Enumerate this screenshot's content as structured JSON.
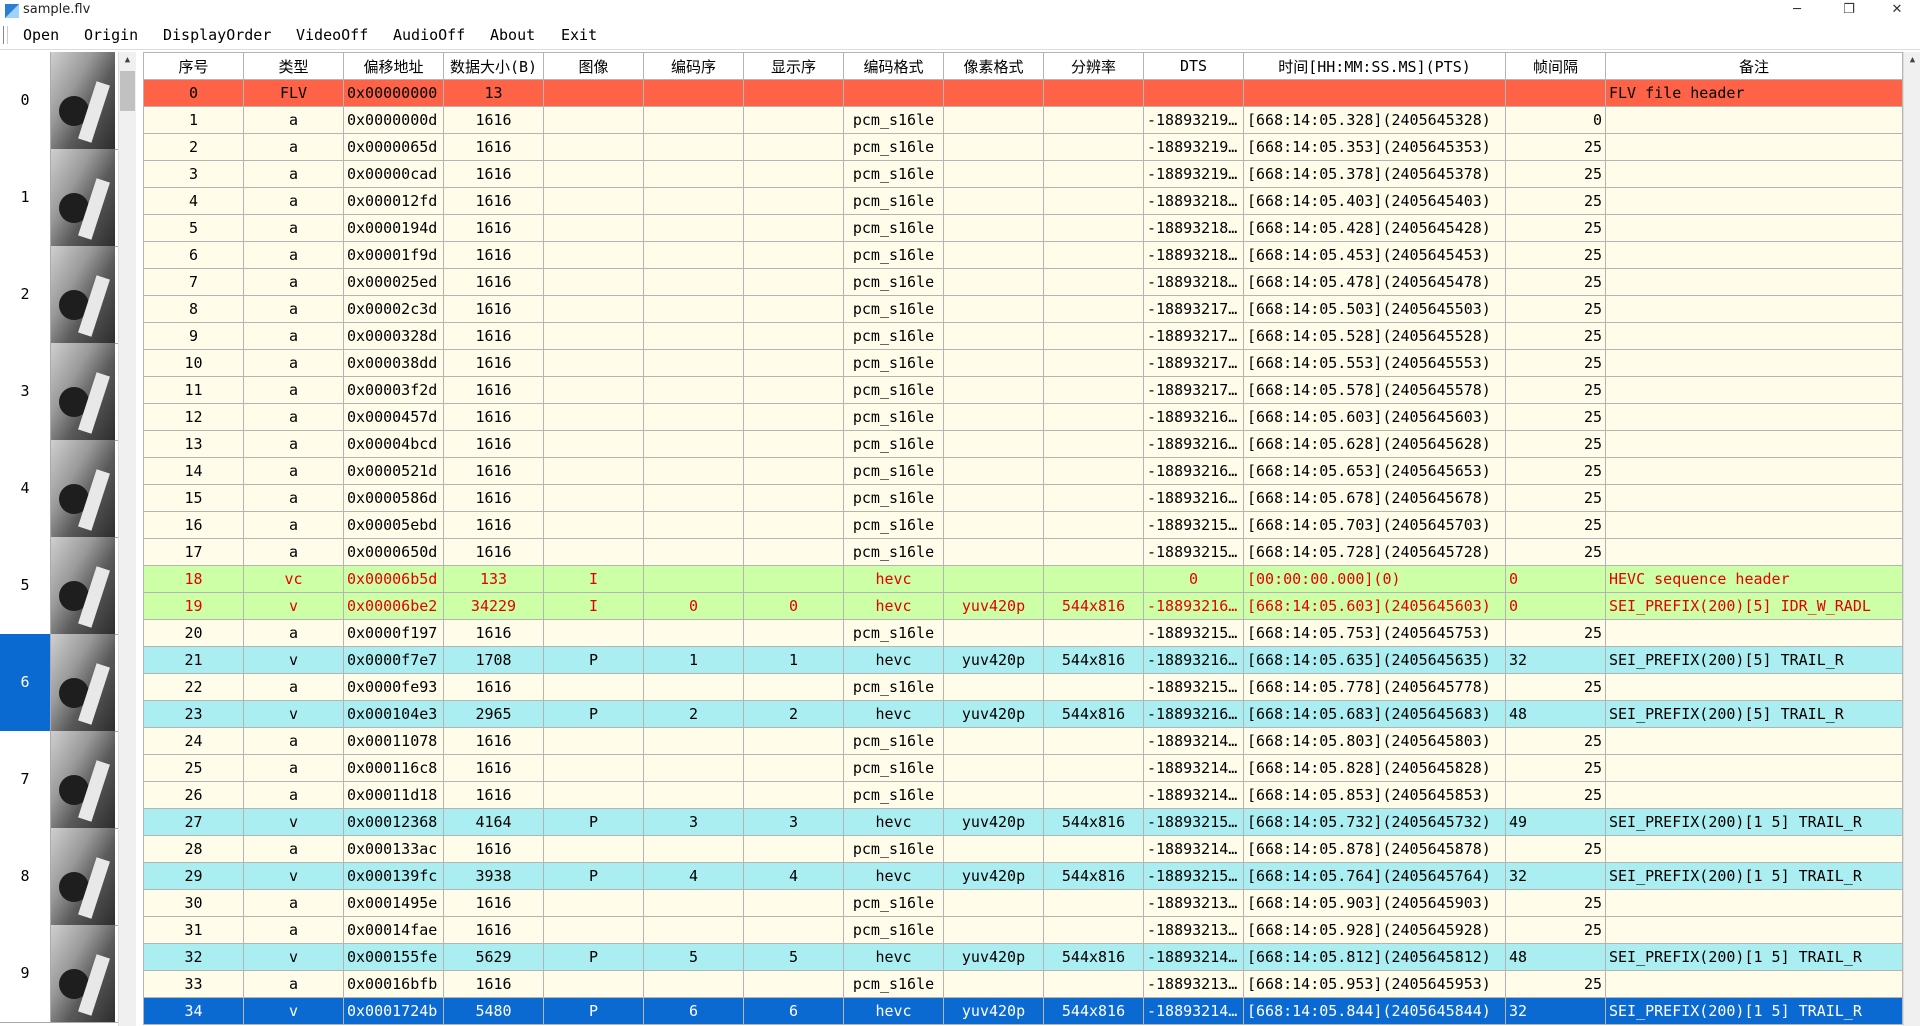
{
  "window": {
    "title": "sample.flv"
  },
  "menu": [
    "Open",
    "Origin",
    "DisplayOrder",
    "VideoOff",
    "AudioOff",
    "About",
    "Exit"
  ],
  "thumbnails": {
    "indices": [
      "0",
      "1",
      "2",
      "3",
      "4",
      "5",
      "6",
      "7",
      "8",
      "9"
    ],
    "selected": "6"
  },
  "table": {
    "columns": [
      "序号",
      "类型",
      "偏移地址",
      "数据大小(B)",
      "图像",
      "编码序",
      "显示序",
      "编码格式",
      "像素格式",
      "分辨率",
      "DTS",
      "时间[HH:MM:SS.MS](PTS)",
      "帧间隔",
      "备注"
    ],
    "rows": [
      {
        "kind": "header",
        "cells": [
          "0",
          "FLV",
          "0x00000000",
          "13",
          "",
          "",
          "",
          "",
          "",
          "",
          "",
          "",
          "",
          "FLV file header"
        ]
      },
      {
        "kind": "audio",
        "cells": [
          "1",
          "a",
          "0x0000000d",
          "1616",
          "",
          "",
          "",
          "pcm_s16le",
          "",
          "",
          "-18893219...",
          "[668:14:05.328](2405645328)",
          "0",
          ""
        ]
      },
      {
        "kind": "audio",
        "cells": [
          "2",
          "a",
          "0x0000065d",
          "1616",
          "",
          "",
          "",
          "pcm_s16le",
          "",
          "",
          "-18893219...",
          "[668:14:05.353](2405645353)",
          "25",
          ""
        ]
      },
      {
        "kind": "audio",
        "cells": [
          "3",
          "a",
          "0x00000cad",
          "1616",
          "",
          "",
          "",
          "pcm_s16le",
          "",
          "",
          "-18893219...",
          "[668:14:05.378](2405645378)",
          "25",
          ""
        ]
      },
      {
        "kind": "audio",
        "cells": [
          "4",
          "a",
          "0x000012fd",
          "1616",
          "",
          "",
          "",
          "pcm_s16le",
          "",
          "",
          "-18893218...",
          "[668:14:05.403](2405645403)",
          "25",
          ""
        ]
      },
      {
        "kind": "audio",
        "cells": [
          "5",
          "a",
          "0x0000194d",
          "1616",
          "",
          "",
          "",
          "pcm_s16le",
          "",
          "",
          "-18893218...",
          "[668:14:05.428](2405645428)",
          "25",
          ""
        ]
      },
      {
        "kind": "audio",
        "cells": [
          "6",
          "a",
          "0x00001f9d",
          "1616",
          "",
          "",
          "",
          "pcm_s16le",
          "",
          "",
          "-18893218...",
          "[668:14:05.453](2405645453)",
          "25",
          ""
        ]
      },
      {
        "kind": "audio",
        "cells": [
          "7",
          "a",
          "0x000025ed",
          "1616",
          "",
          "",
          "",
          "pcm_s16le",
          "",
          "",
          "-18893218...",
          "[668:14:05.478](2405645478)",
          "25",
          ""
        ]
      },
      {
        "kind": "audio",
        "cells": [
          "8",
          "a",
          "0x00002c3d",
          "1616",
          "",
          "",
          "",
          "pcm_s16le",
          "",
          "",
          "-18893217...",
          "[668:14:05.503](2405645503)",
          "25",
          ""
        ]
      },
      {
        "kind": "audio",
        "cells": [
          "9",
          "a",
          "0x0000328d",
          "1616",
          "",
          "",
          "",
          "pcm_s16le",
          "",
          "",
          "-18893217...",
          "[668:14:05.528](2405645528)",
          "25",
          ""
        ]
      },
      {
        "kind": "audio",
        "cells": [
          "10",
          "a",
          "0x000038dd",
          "1616",
          "",
          "",
          "",
          "pcm_s16le",
          "",
          "",
          "-18893217...",
          "[668:14:05.553](2405645553)",
          "25",
          ""
        ]
      },
      {
        "kind": "audio",
        "cells": [
          "11",
          "a",
          "0x00003f2d",
          "1616",
          "",
          "",
          "",
          "pcm_s16le",
          "",
          "",
          "-18893217...",
          "[668:14:05.578](2405645578)",
          "25",
          ""
        ]
      },
      {
        "kind": "audio",
        "cells": [
          "12",
          "a",
          "0x0000457d",
          "1616",
          "",
          "",
          "",
          "pcm_s16le",
          "",
          "",
          "-18893216...",
          "[668:14:05.603](2405645603)",
          "25",
          ""
        ]
      },
      {
        "kind": "audio",
        "cells": [
          "13",
          "a",
          "0x00004bcd",
          "1616",
          "",
          "",
          "",
          "pcm_s16le",
          "",
          "",
          "-18893216...",
          "[668:14:05.628](2405645628)",
          "25",
          ""
        ]
      },
      {
        "kind": "audio",
        "cells": [
          "14",
          "a",
          "0x0000521d",
          "1616",
          "",
          "",
          "",
          "pcm_s16le",
          "",
          "",
          "-18893216...",
          "[668:14:05.653](2405645653)",
          "25",
          ""
        ]
      },
      {
        "kind": "audio",
        "cells": [
          "15",
          "a",
          "0x0000586d",
          "1616",
          "",
          "",
          "",
          "pcm_s16le",
          "",
          "",
          "-18893216...",
          "[668:14:05.678](2405645678)",
          "25",
          ""
        ]
      },
      {
        "kind": "audio",
        "cells": [
          "16",
          "a",
          "0x00005ebd",
          "1616",
          "",
          "",
          "",
          "pcm_s16le",
          "",
          "",
          "-18893215...",
          "[668:14:05.703](2405645703)",
          "25",
          ""
        ]
      },
      {
        "kind": "audio",
        "cells": [
          "17",
          "a",
          "0x0000650d",
          "1616",
          "",
          "",
          "",
          "pcm_s16le",
          "",
          "",
          "-18893215...",
          "[668:14:05.728](2405645728)",
          "25",
          ""
        ]
      },
      {
        "kind": "seq",
        "cells": [
          "18",
          "vc",
          "0x00006b5d",
          "133",
          "I",
          "",
          "",
          "hevc",
          "",
          "",
          "0",
          "[00:00:00.000](0)",
          "0",
          "HEVC sequence header"
        ]
      },
      {
        "kind": "seq",
        "cells": [
          "19",
          "v",
          "0x00006be2",
          "34229",
          "I",
          "0",
          "0",
          "hevc",
          "yuv420p",
          "544x816",
          "-18893216...",
          "[668:14:05.603](2405645603)",
          "0",
          "SEI_PREFIX(200)[5] IDR_W_RADL"
        ]
      },
      {
        "kind": "audio",
        "cells": [
          "20",
          "a",
          "0x0000f197",
          "1616",
          "",
          "",
          "",
          "pcm_s16le",
          "",
          "",
          "-18893215...",
          "[668:14:05.753](2405645753)",
          "25",
          ""
        ]
      },
      {
        "kind": "video",
        "cells": [
          "21",
          "v",
          "0x0000f7e7",
          "1708",
          "P",
          "1",
          "1",
          "hevc",
          "yuv420p",
          "544x816",
          "-18893216...",
          "[668:14:05.635](2405645635)",
          "32",
          "SEI_PREFIX(200)[5] TRAIL_R"
        ]
      },
      {
        "kind": "audio",
        "cells": [
          "22",
          "a",
          "0x0000fe93",
          "1616",
          "",
          "",
          "",
          "pcm_s16le",
          "",
          "",
          "-18893215...",
          "[668:14:05.778](2405645778)",
          "25",
          ""
        ]
      },
      {
        "kind": "video",
        "cells": [
          "23",
          "v",
          "0x000104e3",
          "2965",
          "P",
          "2",
          "2",
          "hevc",
          "yuv420p",
          "544x816",
          "-18893216...",
          "[668:14:05.683](2405645683)",
          "48",
          "SEI_PREFIX(200)[5] TRAIL_R"
        ]
      },
      {
        "kind": "audio",
        "cells": [
          "24",
          "a",
          "0x00011078",
          "1616",
          "",
          "",
          "",
          "pcm_s16le",
          "",
          "",
          "-18893214...",
          "[668:14:05.803](2405645803)",
          "25",
          ""
        ]
      },
      {
        "kind": "audio",
        "cells": [
          "25",
          "a",
          "0x000116c8",
          "1616",
          "",
          "",
          "",
          "pcm_s16le",
          "",
          "",
          "-18893214...",
          "[668:14:05.828](2405645828)",
          "25",
          ""
        ]
      },
      {
        "kind": "audio",
        "cells": [
          "26",
          "a",
          "0x00011d18",
          "1616",
          "",
          "",
          "",
          "pcm_s16le",
          "",
          "",
          "-18893214...",
          "[668:14:05.853](2405645853)",
          "25",
          ""
        ]
      },
      {
        "kind": "video",
        "cells": [
          "27",
          "v",
          "0x00012368",
          "4164",
          "P",
          "3",
          "3",
          "hevc",
          "yuv420p",
          "544x816",
          "-18893215...",
          "[668:14:05.732](2405645732)",
          "49",
          "SEI_PREFIX(200)[1 5] TRAIL_R"
        ]
      },
      {
        "kind": "audio",
        "cells": [
          "28",
          "a",
          "0x000133ac",
          "1616",
          "",
          "",
          "",
          "pcm_s16le",
          "",
          "",
          "-18893214...",
          "[668:14:05.878](2405645878)",
          "25",
          ""
        ]
      },
      {
        "kind": "video",
        "cells": [
          "29",
          "v",
          "0x000139fc",
          "3938",
          "P",
          "4",
          "4",
          "hevc",
          "yuv420p",
          "544x816",
          "-18893215...",
          "[668:14:05.764](2405645764)",
          "32",
          "SEI_PREFIX(200)[1 5] TRAIL_R"
        ]
      },
      {
        "kind": "audio",
        "cells": [
          "30",
          "a",
          "0x0001495e",
          "1616",
          "",
          "",
          "",
          "pcm_s16le",
          "",
          "",
          "-18893213...",
          "[668:14:05.903](2405645903)",
          "25",
          ""
        ]
      },
      {
        "kind": "audio",
        "cells": [
          "31",
          "a",
          "0x00014fae",
          "1616",
          "",
          "",
          "",
          "pcm_s16le",
          "",
          "",
          "-18893213...",
          "[668:14:05.928](2405645928)",
          "25",
          ""
        ]
      },
      {
        "kind": "video",
        "cells": [
          "32",
          "v",
          "0x000155fe",
          "5629",
          "P",
          "5",
          "5",
          "hevc",
          "yuv420p",
          "544x816",
          "-18893214...",
          "[668:14:05.812](2405645812)",
          "48",
          "SEI_PREFIX(200)[1 5] TRAIL_R"
        ]
      },
      {
        "kind": "audio",
        "cells": [
          "33",
          "a",
          "0x00016bfb",
          "1616",
          "",
          "",
          "",
          "pcm_s16le",
          "",
          "",
          "-18893213...",
          "[668:14:05.953](2405645953)",
          "25",
          ""
        ]
      },
      {
        "kind": "selected",
        "cells": [
          "34",
          "v",
          "0x0001724b",
          "5480",
          "P",
          "6",
          "6",
          "hevc",
          "yuv420p",
          "544x816",
          "-18893214...",
          "[668:14:05.844](2405645844)",
          "32",
          "SEI_PREFIX(200)[1 5] TRAIL_R"
        ]
      }
    ]
  },
  "colors": {
    "audio_row": "#fffcea",
    "video_row": "#aaeef2",
    "sequence_row": "#ccffa6",
    "header_row": "#ff6347",
    "selected": "#0a6ad2"
  }
}
